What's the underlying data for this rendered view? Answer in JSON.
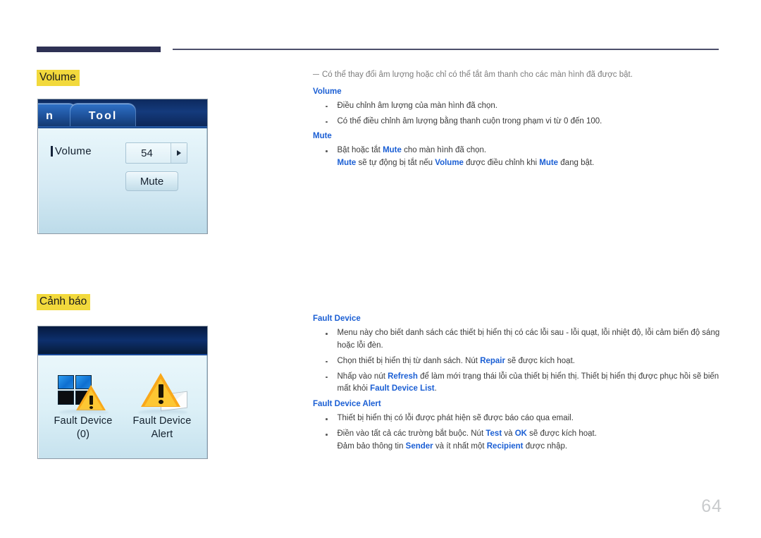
{
  "page": {
    "number": "64"
  },
  "headings": {
    "volume": "Volume",
    "canh_bao": "Cảnh báo"
  },
  "colors": {
    "highlight": "#f2d93c",
    "keyword_blue": "#1b5fd4",
    "rule_navy": "#2e3154",
    "page_number_gray": "#c9cbcd"
  },
  "figure_volume": {
    "tab_partial_label": "n",
    "tab_tool_label": "Tool",
    "volume_label": "Volume",
    "volume_value": "54",
    "mute_button_label": "Mute"
  },
  "figure_fault": {
    "item_device_label_line1": "Fault Device",
    "item_device_label_line2": "(0)",
    "item_alert_label_line1": "Fault Device",
    "item_alert_label_line2": "Alert"
  },
  "volume_section": {
    "intro": "Có thể thay đổi âm lượng hoặc chỉ có thể tắt âm thanh cho các màn hình đã được bật.",
    "subhead_volume": "Volume",
    "bullets_volume": [
      "Điều chỉnh âm lượng của màn hình đã chọn.",
      "Có thể điều chỉnh âm lượng bằng thanh cuộn trong phạm vi từ 0 đến 100."
    ],
    "subhead_mute": "Mute",
    "bullet_mute": {
      "line1_pre": "Bật hoặc tắt ",
      "line1_kw": "Mute",
      "line1_post": " cho màn hình đã chọn.",
      "line2_kw1": "Mute",
      "line2_mid1": " sẽ tự động bị tắt nếu ",
      "line2_kw2": "Volume",
      "line2_mid2": " được điều chỉnh khi ",
      "line2_kw3": "Mute",
      "line2_post": " đang bật."
    }
  },
  "fault_section": {
    "subhead_fault_device": "Fault Device",
    "bullet_list": "Menu này cho biết danh sách các thiết bị hiển thị có các lỗi sau - lỗi quạt, lỗi nhiệt độ, lỗi cảm biến độ sáng hoặc lỗi đèn.",
    "bullet_repair": {
      "pre": "Chọn thiết bị hiển thị từ danh sách. Nút ",
      "kw": "Repair",
      "post": " sẽ được kích hoạt."
    },
    "bullet_refresh": {
      "pre": "Nhấp vào nút ",
      "kw1": "Refresh",
      "mid": " để làm mới trạng thái lỗi của thiết bị hiển thị. Thiết bị hiển thị được phục hồi sẽ biến mất khỏi ",
      "kw2": "Fault Device List",
      "post": "."
    },
    "subhead_fault_alert": "Fault Device Alert",
    "bullet_email": "Thiết bị hiển thị có lỗi được phát hiện sẽ được báo cáo qua email.",
    "bullet_fields": {
      "line1_pre": "Điền vào tất cả các trường bắt buộc. Nút ",
      "line1_kw1": "Test",
      "line1_mid": " và ",
      "line1_kw2": "OK",
      "line1_post": " sẽ được kích hoạt.",
      "line2_pre": "Đảm bảo thông tin ",
      "line2_kw1": "Sender",
      "line2_mid": " và ít nhất một ",
      "line2_kw2": "Recipient",
      "line2_post": " được nhập."
    }
  }
}
